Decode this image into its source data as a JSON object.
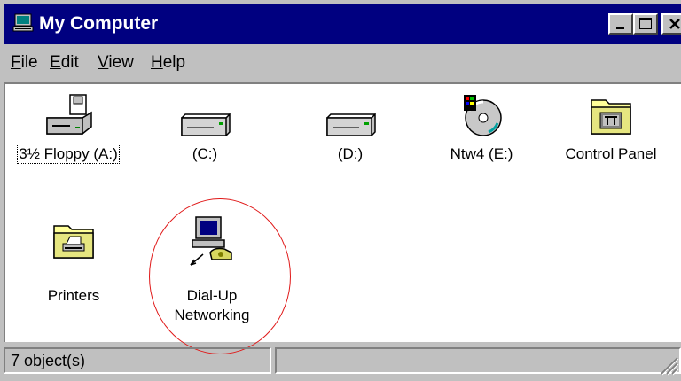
{
  "window": {
    "title": "My Computer"
  },
  "menu": {
    "file": {
      "first": "F",
      "rest": "ile"
    },
    "edit": {
      "first": "E",
      "rest": "dit"
    },
    "view": {
      "first": "V",
      "rest": "iew"
    },
    "help": {
      "first": "H",
      "rest": "elp"
    }
  },
  "items": {
    "floppy": {
      "label": "3½ Floppy (A:)",
      "icon": "floppy-drive-icon"
    },
    "c_drive": {
      "label": "(C:)",
      "icon": "hard-drive-icon"
    },
    "d_drive": {
      "label": "(D:)",
      "icon": "hard-drive-icon"
    },
    "cdrom": {
      "label": "Ntw4 (E:)",
      "icon": "cd-rom-icon"
    },
    "control_panel": {
      "label": "Control Panel",
      "icon": "control-panel-folder-icon"
    },
    "printers": {
      "label": "Printers",
      "icon": "printers-folder-icon"
    },
    "dialup": {
      "label1": "Dial-Up",
      "label2": "Networking",
      "icon": "dial-up-networking-icon"
    }
  },
  "status": {
    "objects": "7 object(s)",
    "right": ""
  },
  "colors": {
    "titlebar": "#000080",
    "face": "#c0c0c0",
    "highlight_circle": "#e01818"
  }
}
